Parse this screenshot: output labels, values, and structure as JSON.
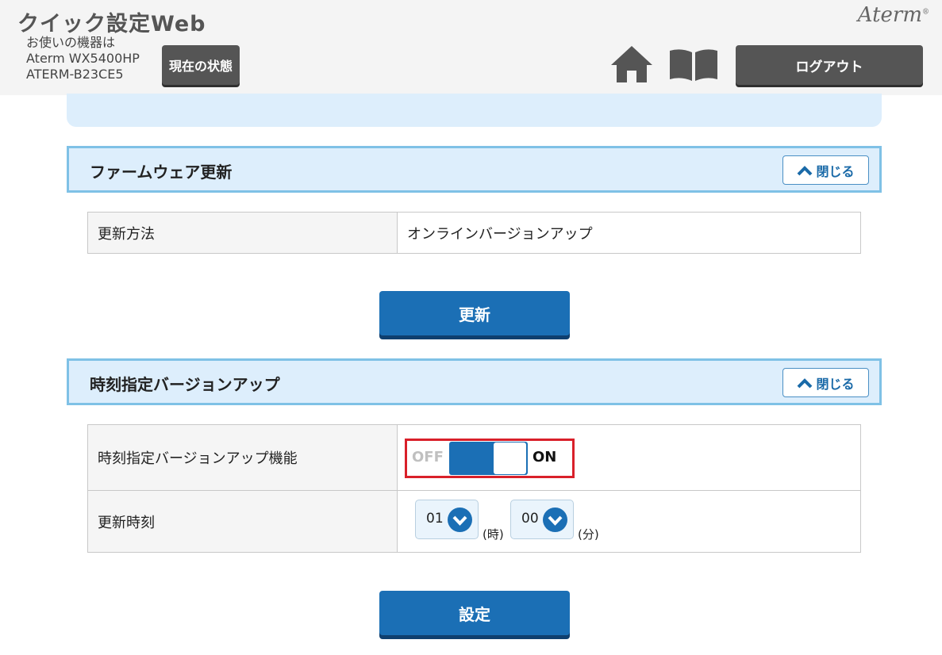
{
  "header": {
    "app_title": "クイック設定Web",
    "device_label": "お使いの機器は",
    "device_model": "Aterm WX5400HP",
    "device_id": "ATERM-B23CE5",
    "status_button": "現在の状態",
    "logo": "Aterm",
    "logout_button": "ログアウト"
  },
  "sections": {
    "firmware": {
      "title": "ファームウェア更新",
      "close_label": "閉じる",
      "rows": [
        {
          "label": "更新方法",
          "value": "オンラインバージョンアップ"
        }
      ],
      "action_button": "更新"
    },
    "scheduled": {
      "title": "時刻指定バージョンアップ",
      "close_label": "閉じる",
      "function_label": "時刻指定バージョンアップ機能",
      "toggle": {
        "off_label": "OFF",
        "on_label": "ON",
        "state": "ON"
      },
      "time_label": "更新時刻",
      "hour_value": "01",
      "hour_unit": "(時)",
      "minute_value": "00",
      "minute_unit": "(分)",
      "action_button": "設定"
    }
  },
  "colors": {
    "primary_blue": "#1b6fb5",
    "panel_blue": "#ddeefc",
    "highlight_red": "#d9202a"
  }
}
